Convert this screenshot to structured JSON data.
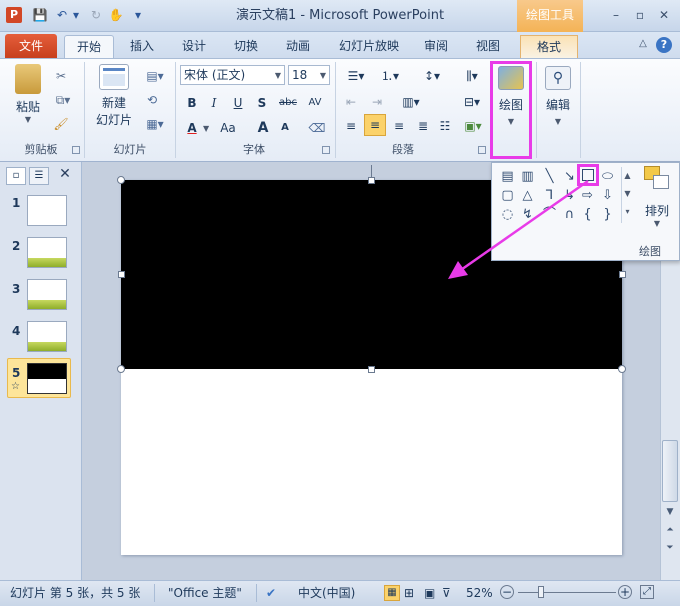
{
  "window": {
    "app_icon": "P",
    "title": "演示文稿1 - Microsoft PowerPoint",
    "context_tab_header": "绘图工具",
    "controls": [
      "–",
      "▫",
      "✕"
    ],
    "help": "?"
  },
  "quick_access": {
    "save": "💾",
    "undo": "↶",
    "redo": "↻",
    "dropdown": "▾"
  },
  "tabs": {
    "file": "文件",
    "items": [
      "开始",
      "插入",
      "设计",
      "切换",
      "动画",
      "幻灯片放映",
      "审阅",
      "视图",
      "格式"
    ]
  },
  "ribbon": {
    "clipboard": {
      "label": "剪贴板",
      "paste": "粘贴"
    },
    "slides": {
      "label": "幻灯片",
      "new_slide_line1": "新建",
      "new_slide_line2": "幻灯片"
    },
    "font": {
      "label": "字体",
      "family": "宋体 (正文)",
      "size": "18",
      "buttons": [
        "B",
        "I",
        "U",
        "S",
        "abc",
        "AV",
        "A",
        "Aa",
        "A",
        "A"
      ]
    },
    "paragraph": {
      "label": "段落"
    },
    "drawing": {
      "button": "绘图",
      "group_label": "绘图"
    },
    "editing": {
      "button": "编辑"
    },
    "arrange": {
      "button": "排列"
    }
  },
  "slides_panel": {
    "numbers": [
      "1",
      "2",
      "3",
      "4",
      "5"
    ],
    "transition_marker": "☆"
  },
  "status": {
    "slide_info": "幻灯片 第 5 张，共 5 张",
    "theme": "\"Office 主题\"",
    "language": "中文(中国)",
    "zoom": "52%",
    "zoom_level": 52
  },
  "colors": {
    "highlight": "#e83be8",
    "file_tab": "#c73f1d",
    "context_tab": "#f4b356",
    "arrow": "#e83be8",
    "selected_shape": "#000000"
  }
}
